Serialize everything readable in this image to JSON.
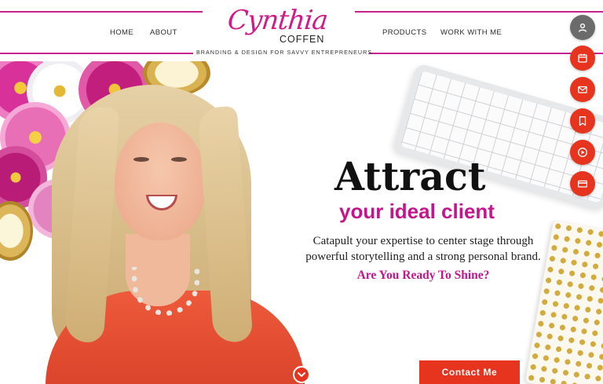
{
  "nav": {
    "home": "HOME",
    "about": "ABOUT",
    "products": "PRODUCTS",
    "work_with_me": "WORK WITH ME"
  },
  "logo": {
    "script": "Cynthia",
    "surname": "COFFEN",
    "tagline": "BRANDING & DESIGN FOR SAVVY ENTREPRENEURS"
  },
  "hero": {
    "headline": "Attract",
    "subheadline": "your ideal client",
    "body_line1": "Catapult your expertise to center stage through",
    "body_line2": "powerful storytelling and a strong personal brand.",
    "question": "Are You Ready To Shine?",
    "cta_label": "Contact Me"
  },
  "side_buttons": [
    {
      "icon": "user-icon"
    },
    {
      "icon": "calendar-icon"
    },
    {
      "icon": "mail-icon"
    },
    {
      "icon": "bookmark-icon"
    },
    {
      "icon": "play-icon"
    },
    {
      "icon": "credit-card-icon"
    }
  ],
  "colors": {
    "brand_pink": "#c4168c",
    "accent_red": "#e6341f",
    "rule_pink": "#c4238e",
    "user_button_gray": "#6b6b6b"
  }
}
